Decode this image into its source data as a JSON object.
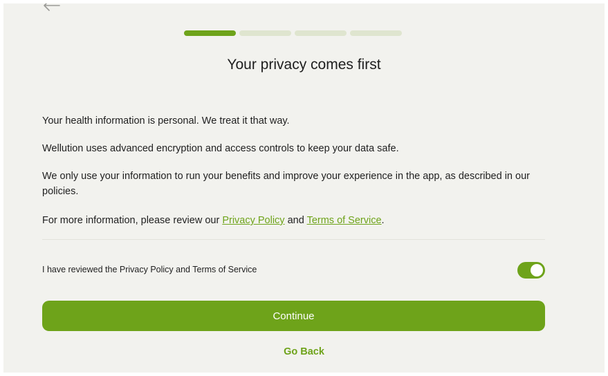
{
  "header": {
    "back_icon": "arrow-left-icon",
    "progress": {
      "total_steps": 4,
      "current_step": 1
    },
    "title": "Your privacy comes first"
  },
  "content": {
    "p1": "Your health information is personal. We treat it that way.",
    "p2": "Wellution uses advanced encryption and access controls to keep your data safe.",
    "p3": "We only use your information to run your benefits and improve your experience in the app, as described in our policies.",
    "p4_prefix": "For more information, please review our ",
    "privacy_link": "Privacy Policy",
    "p4_middle": " and ",
    "terms_link": "Terms of Service",
    "p4_suffix": "."
  },
  "ack": {
    "label": "I have reviewed the Privacy Policy and Terms of Service",
    "toggle_on": true
  },
  "actions": {
    "continue_label": "Continue",
    "go_back_label": "Go Back"
  },
  "colors": {
    "accent": "#6ea31a",
    "inactive_step": "#dfe5cf",
    "background": "#f2f2ee"
  }
}
